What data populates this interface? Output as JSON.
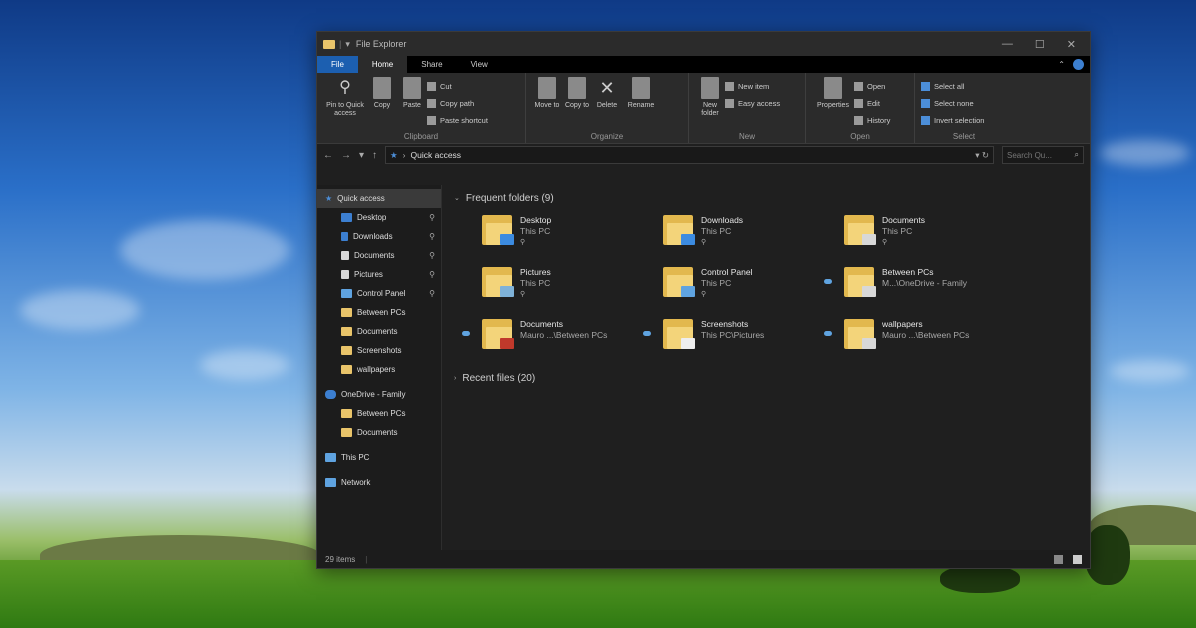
{
  "window": {
    "title": "File Explorer",
    "controls": {
      "minimize": "—",
      "maximize": "☐",
      "close": "✕"
    }
  },
  "tabs": [
    "File",
    "Home",
    "Share",
    "View"
  ],
  "active_tab": "Home",
  "ribbon": {
    "clipboard": {
      "name": "Clipboard",
      "pin": "Pin to Quick access",
      "copy": "Copy",
      "paste": "Paste",
      "cut": "Cut",
      "copy_path": "Copy path",
      "paste_shortcut": "Paste shortcut"
    },
    "organize": {
      "name": "Organize",
      "move_to": "Move to",
      "copy_to": "Copy to",
      "delete": "Delete",
      "rename": "Rename"
    },
    "new": {
      "name": "New",
      "new_folder": "New folder",
      "new_item": "New item",
      "easy_access": "Easy access"
    },
    "open": {
      "name": "Open",
      "properties": "Properties",
      "open": "Open",
      "edit": "Edit",
      "history": "History"
    },
    "select": {
      "name": "Select",
      "select_all": "Select all",
      "select_none": "Select none",
      "invert": "Invert selection"
    }
  },
  "address": {
    "path": "Quick access",
    "search_placeholder": "Search Qu..."
  },
  "nav": {
    "quick_access": "Quick access",
    "items": [
      {
        "label": "Desktop",
        "pinned": true
      },
      {
        "label": "Downloads",
        "pinned": true
      },
      {
        "label": "Documents",
        "pinned": true
      },
      {
        "label": "Pictures",
        "pinned": true
      },
      {
        "label": "Control Panel",
        "pinned": true
      },
      {
        "label": "Between PCs",
        "pinned": false
      },
      {
        "label": "Documents",
        "pinned": false
      },
      {
        "label": "Screenshots",
        "pinned": false
      },
      {
        "label": "wallpapers",
        "pinned": false
      }
    ],
    "onedrive": "OneDrive - Family",
    "onedrive_items": [
      "Between PCs",
      "Documents"
    ],
    "this_pc": "This PC",
    "network": "Network"
  },
  "content": {
    "frequent_header": "Frequent folders (9)",
    "recent_header": "Recent files (20)",
    "folders": [
      {
        "name": "Desktop",
        "sub": "This PC",
        "pinned": true,
        "badge": "#3c8be0"
      },
      {
        "name": "Downloads",
        "sub": "This PC",
        "pinned": true,
        "badge": "#3c8be0"
      },
      {
        "name": "Documents",
        "sub": "This PC",
        "pinned": true,
        "badge": "#d8d8d8"
      },
      {
        "name": "Pictures",
        "sub": "This PC",
        "pinned": true,
        "badge": "#7fb2d8"
      },
      {
        "name": "Control Panel",
        "sub": "This PC",
        "pinned": true,
        "badge": "#5fa3e0"
      },
      {
        "name": "Between PCs",
        "sub": "M...\\OneDrive - Family",
        "pinned": false,
        "badge": "#d8d8d8"
      },
      {
        "name": "Documents",
        "sub": "Mauro ...\\Between PCs",
        "pinned": false,
        "badge": "#c0392b"
      },
      {
        "name": "Screenshots",
        "sub": "This PC\\Pictures",
        "pinned": false,
        "badge": "#eeeeee"
      },
      {
        "name": "wallpapers",
        "sub": "Mauro ...\\Between PCs",
        "pinned": false,
        "badge": "#d8d8d8"
      }
    ]
  },
  "status": {
    "items": "29 items"
  },
  "pin_glyph": "📌"
}
